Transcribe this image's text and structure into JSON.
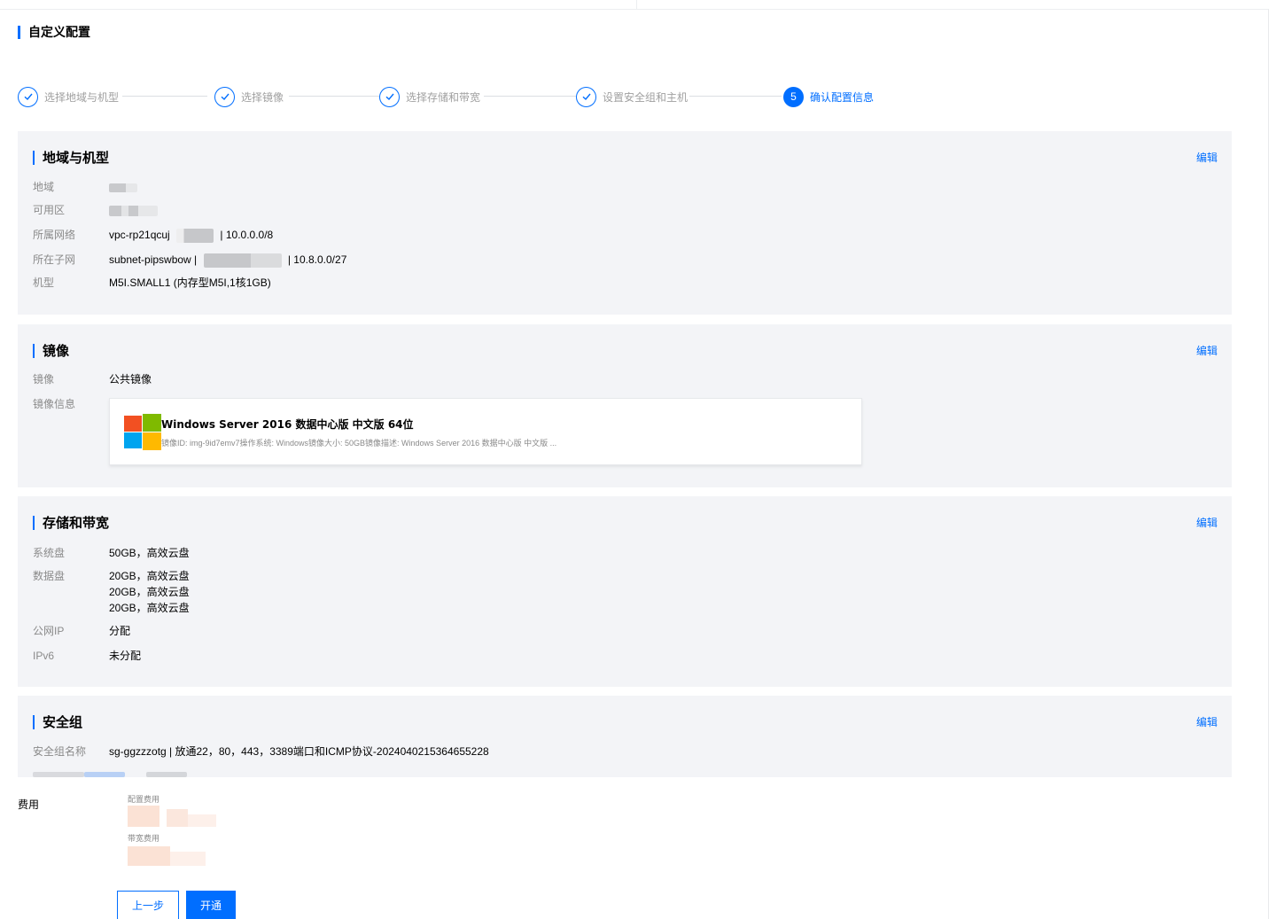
{
  "page": {
    "title": "自定义配置"
  },
  "steps": [
    {
      "label": "选择地域与机型",
      "status": "done"
    },
    {
      "label": "选择镜像",
      "status": "done"
    },
    {
      "label": "选择存储和带宽",
      "status": "done"
    },
    {
      "label": "设置安全组和主机",
      "status": "done"
    },
    {
      "label": "确认配置信息",
      "status": "active",
      "number": "5"
    }
  ],
  "region_section": {
    "title": "地域与机型",
    "edit": "编辑",
    "rows": {
      "region": {
        "key": "地域"
      },
      "zone": {
        "key": "可用区"
      },
      "network": {
        "key": "所属网络",
        "prefix": "vpc-rp21qcuj",
        "suffix": "| 10.0.0.0/8"
      },
      "subnet": {
        "key": "所在子网",
        "prefix": "subnet-pipswbow |",
        "suffix": "| 10.8.0.0/27"
      },
      "model": {
        "key": "机型",
        "value": "M5I.SMALL1 (内存型M5I,1核1GB)"
      }
    }
  },
  "image_section": {
    "title": "镜像",
    "edit": "编辑",
    "image_key": "镜像",
    "image_value": "公共镜像",
    "info_key": "镜像信息",
    "card": {
      "title": "Windows Server 2016 数据中心版 中文版 64位",
      "desc": "镜像ID: img-9id7emv7操作系统: Windows镜像大小: 50GB镜像描述: Windows Server 2016 数据中心版 中文版 ..."
    },
    "logo_colors": [
      "#f25022",
      "#7fba00",
      "#00a4ef",
      "#ffb900"
    ]
  },
  "storage_section": {
    "title": "存储和带宽",
    "edit": "编辑",
    "system_disk": {
      "key": "系统盘",
      "value": "50GB，高效云盘"
    },
    "data_disk": {
      "key": "数据盘",
      "values": [
        "20GB，高效云盘",
        "20GB，高效云盘",
        "20GB，高效云盘"
      ]
    },
    "public_ip": {
      "key": "公网IP",
      "value": "分配"
    },
    "ipv6": {
      "key": "IPv6",
      "value": "未分配"
    }
  },
  "security_section": {
    "title": "安全组",
    "edit": "编辑",
    "name": {
      "key": "安全组名称",
      "value": "sg-ggzzzotg | 放通22，80，443，3389端口和ICMP协议-20240402153646552​28"
    }
  },
  "fee": {
    "label": "费用",
    "config_fee_label": "配置费用",
    "bandwidth_fee_label": "带宽费用"
  },
  "buttons": {
    "prev": "上一步",
    "open": "开通"
  },
  "colors": {
    "accent": "#006eff",
    "section_bg": "#f3f4f7"
  }
}
